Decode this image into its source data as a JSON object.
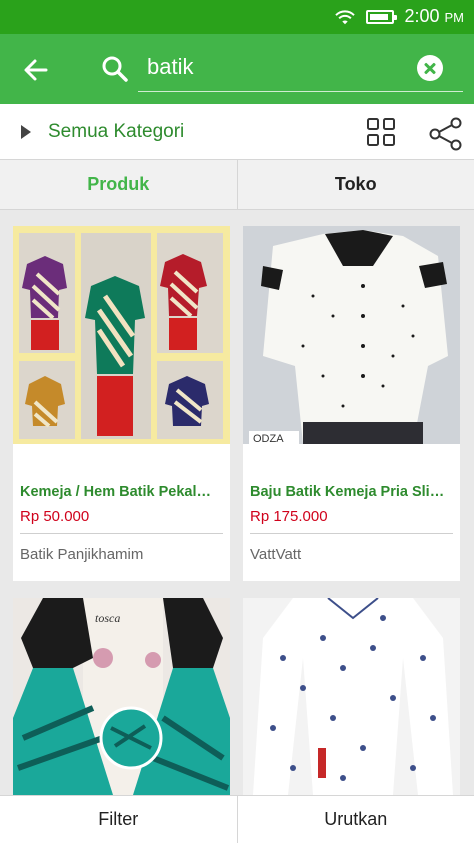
{
  "status_bar": {
    "time": "2:00",
    "ampm": "PM",
    "battery_level": 0.9
  },
  "search": {
    "query": "batik"
  },
  "category": {
    "label": "Semua Kategori"
  },
  "tabs": [
    {
      "label": "Produk",
      "active": true
    },
    {
      "label": "Toko",
      "active": false
    }
  ],
  "products": [
    {
      "name": "Kemeja / Hem Batik Pekal…",
      "price": "Rp 50.000",
      "shop": "Batik Panjikhamim"
    },
    {
      "name": "Baju Batik Kemeja Pria Sli…",
      "price": "Rp 175.000",
      "shop": "VattVatt",
      "image_text": "ODZA"
    },
    {
      "name": "",
      "price": "",
      "shop": "",
      "image_text": "tosca"
    },
    {
      "name": "",
      "price": "",
      "shop": ""
    }
  ],
  "bottom_bar": {
    "filter_label": "Filter",
    "sort_label": "Urutkan"
  },
  "colors": {
    "status_bar": "#2aa21b",
    "app_bar": "#42b549",
    "price": "#d0021b",
    "link_green": "#2e8b2e"
  }
}
